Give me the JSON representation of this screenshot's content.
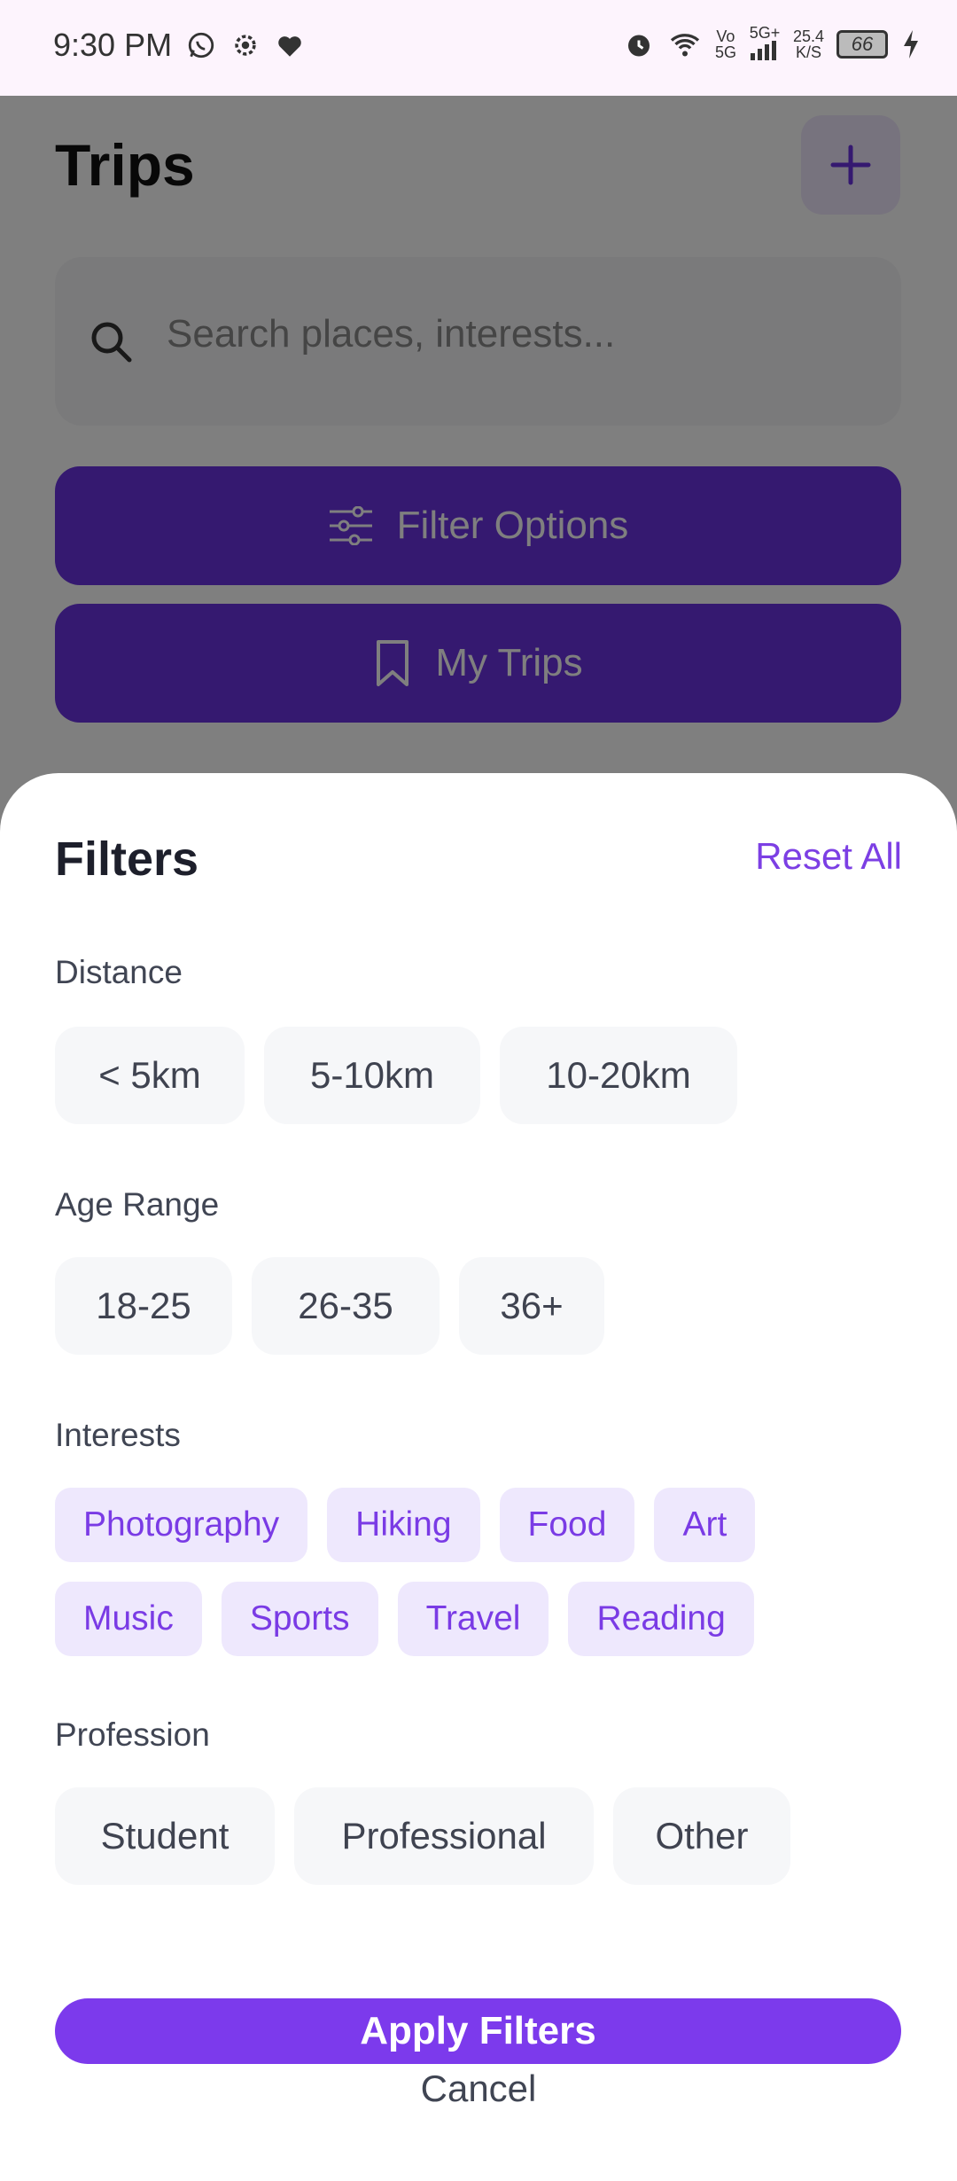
{
  "status_bar": {
    "time": "9:30 PM",
    "net_top": "Vo",
    "net_bottom": "5G",
    "signal_label": "5G+",
    "speed_top": "25.4",
    "speed_bottom": "K/S",
    "battery": "66"
  },
  "header": {
    "title": "Trips"
  },
  "search": {
    "placeholder": "Search places, interests..."
  },
  "actions": {
    "filter_label": "Filter Options",
    "mytrips_label": "My Trips"
  },
  "sheet": {
    "title": "Filters",
    "reset_label": "Reset All",
    "distance": {
      "label": "Distance",
      "options": [
        "< 5km",
        "5-10km",
        "10-20km"
      ]
    },
    "age": {
      "label": "Age Range",
      "options": [
        "18-25",
        "26-35",
        "36+"
      ]
    },
    "interests": {
      "label": "Interests",
      "options": [
        "Photography",
        "Hiking",
        "Food",
        "Art",
        "Music",
        "Sports",
        "Travel",
        "Reading"
      ]
    },
    "profession": {
      "label": "Profession",
      "options": [
        "Student",
        "Professional",
        "Other"
      ]
    },
    "apply_label": "Apply Filters",
    "cancel_label": "Cancel"
  },
  "colors": {
    "accent": "#7c3aec",
    "button": "#6a32e0",
    "tag_bg": "#eee8fd"
  }
}
